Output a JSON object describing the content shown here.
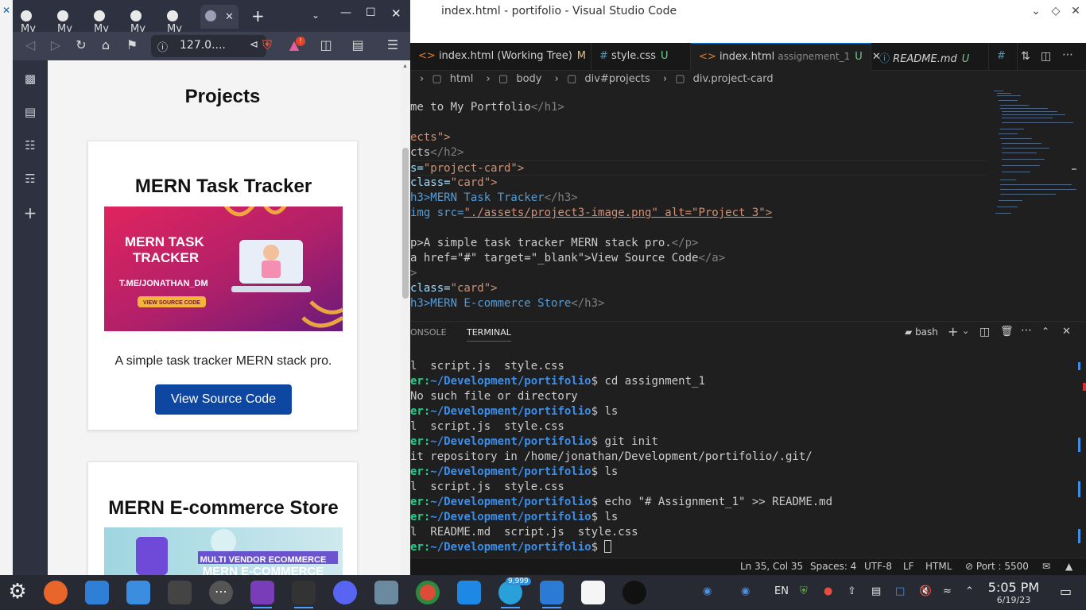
{
  "vscode": {
    "window_title": "index.html - portifolio - Visual Studio Code",
    "tabs": [
      {
        "label": "index.html (Working Tree)",
        "badge": "M",
        "sub": ""
      },
      {
        "label": "style.css",
        "badge": "U",
        "sub": ""
      },
      {
        "label": "index.html",
        "badge": "U",
        "sub": "assignement_1"
      },
      {
        "label": "README.md",
        "badge": "U",
        "sub": ""
      }
    ],
    "tab_overflow": "#",
    "breadcrumb": [
      "html",
      "body",
      "div#projects",
      "div.project-card"
    ],
    "code_lines": [
      {
        "a": "me to My Portfolio",
        "b": "</h1>"
      },
      {
        "a": "",
        "b": ""
      },
      {
        "a": "ects\">",
        "b": ""
      },
      {
        "a": "cts",
        "b": "</h2>"
      },
      {
        "a": "s=",
        "b": "\"project-card\">"
      },
      {
        "a": "class=",
        "b": "\"card\">"
      },
      {
        "a": "h3>MERN Task Tracker",
        "b": "</h3>"
      },
      {
        "a": "img src=",
        "b": "\"./assets/project3-image.png\" alt=\"Project 3\">"
      },
      {
        "a": "",
        "b": ""
      },
      {
        "a": "p>A simple task tracker MERN stack pro.",
        "b": "</p>"
      },
      {
        "a": "a href=\"#\" target=\"_blank\">View Source Code",
        "b": "</a>"
      },
      {
        "a": ">",
        "b": ""
      },
      {
        "a": "class=",
        "b": "\"card\">"
      },
      {
        "a": "h3>MERN E-commerce Store",
        "b": "</h3>"
      }
    ],
    "panel": {
      "tabs": [
        "ONSOLE",
        "TERMINAL"
      ],
      "active": "TERMINAL",
      "shell": "bash"
    },
    "terminal": [
      {
        "user": "",
        "path": "",
        "text": "l  script.js  style.css"
      },
      {
        "user": "er:",
        "path": "~/Development/portifolio",
        "text": "$ cd assignment_1"
      },
      {
        "user": "",
        "path": "",
        "text": "No such file or directory"
      },
      {
        "user": "er:",
        "path": "~/Development/portifolio",
        "text": "$ ls"
      },
      {
        "user": "",
        "path": "",
        "text": "l  script.js  style.css"
      },
      {
        "user": "er:",
        "path": "~/Development/portifolio",
        "text": "$ git init"
      },
      {
        "user": "",
        "path": "",
        "text": "it repository in /home/jonathan/Development/portifolio/.git/"
      },
      {
        "user": "er:",
        "path": "~/Development/portifolio",
        "text": "$ ls"
      },
      {
        "user": "",
        "path": "",
        "text": "l  script.js  style.css"
      },
      {
        "user": "er:",
        "path": "~/Development/portifolio",
        "text": "$ echo \"# Assignment_1\" >> README.md"
      },
      {
        "user": "er:",
        "path": "~/Development/portifolio",
        "text": "$ ls"
      },
      {
        "user": "",
        "path": "",
        "text": "l  README.md  script.js  style.css"
      },
      {
        "user": "er:",
        "path": "~/Development/portifolio",
        "text": "$ "
      }
    ],
    "status": {
      "position": "Ln 35, Col 35",
      "spaces": "Spaces: 4",
      "encoding": "UTF-8",
      "eol": "LF",
      "language": "HTML",
      "port": "Port : 5500"
    }
  },
  "browser": {
    "tab_label": "My",
    "url": "127.0....",
    "extension_badge": "!",
    "page": {
      "section_title": "Projects",
      "cards": [
        {
          "title": "MERN Task Tracker",
          "image": {
            "headline_1": "MERN TASK",
            "headline_2": "TRACKER",
            "handle": "T.ME/JONATHAN_DM",
            "button": "VIEW SOURCE CODE"
          },
          "description": "A simple task tracker MERN stack pro.",
          "link": "View Source Code"
        },
        {
          "title": "MERN E-commerce Store",
          "image": {
            "headline_1": "MULTI VENDOR ECOMMERCE",
            "headline_2": "MERN E-COMMERCE"
          }
        }
      ]
    }
  },
  "taskbar": {
    "lang": "EN",
    "telegram_badge": "9,999",
    "time": "5:05 PM",
    "date": "6/19/23",
    "colors": {
      "vscode_blue": "#0078d4",
      "terminal_green": "#23d18b",
      "terminal_blue": "#3b8eea",
      "page_button": "#0d47a1"
    }
  }
}
